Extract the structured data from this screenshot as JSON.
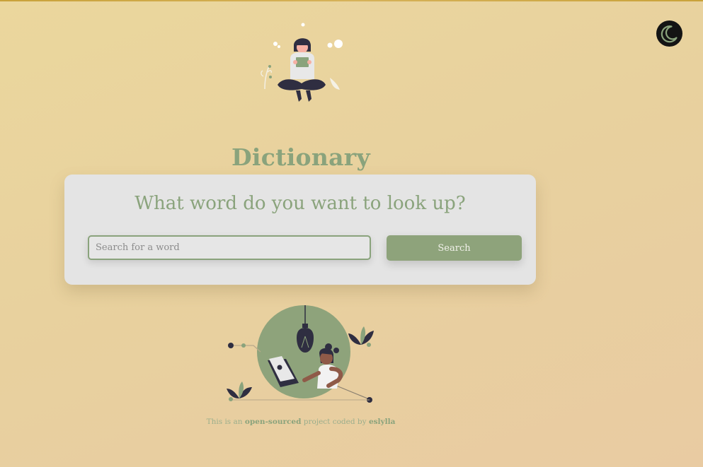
{
  "app": {
    "title": "Dictionary"
  },
  "theme_toggle": {
    "icon": "moon-icon",
    "background": "#141414",
    "icon_color": "#8aa37c"
  },
  "search": {
    "heading": "What word do you want to look up?",
    "placeholder": "Search for a word",
    "value": "",
    "button_label": "Search"
  },
  "footer": {
    "prefix": "This is an",
    "link_open_source": "open-sourced",
    "middle": "project coded by",
    "link_author": "eslylla"
  },
  "colors": {
    "accent": "#8aa37c",
    "card": "#e4e4e4",
    "background": "#e9d3a0"
  }
}
